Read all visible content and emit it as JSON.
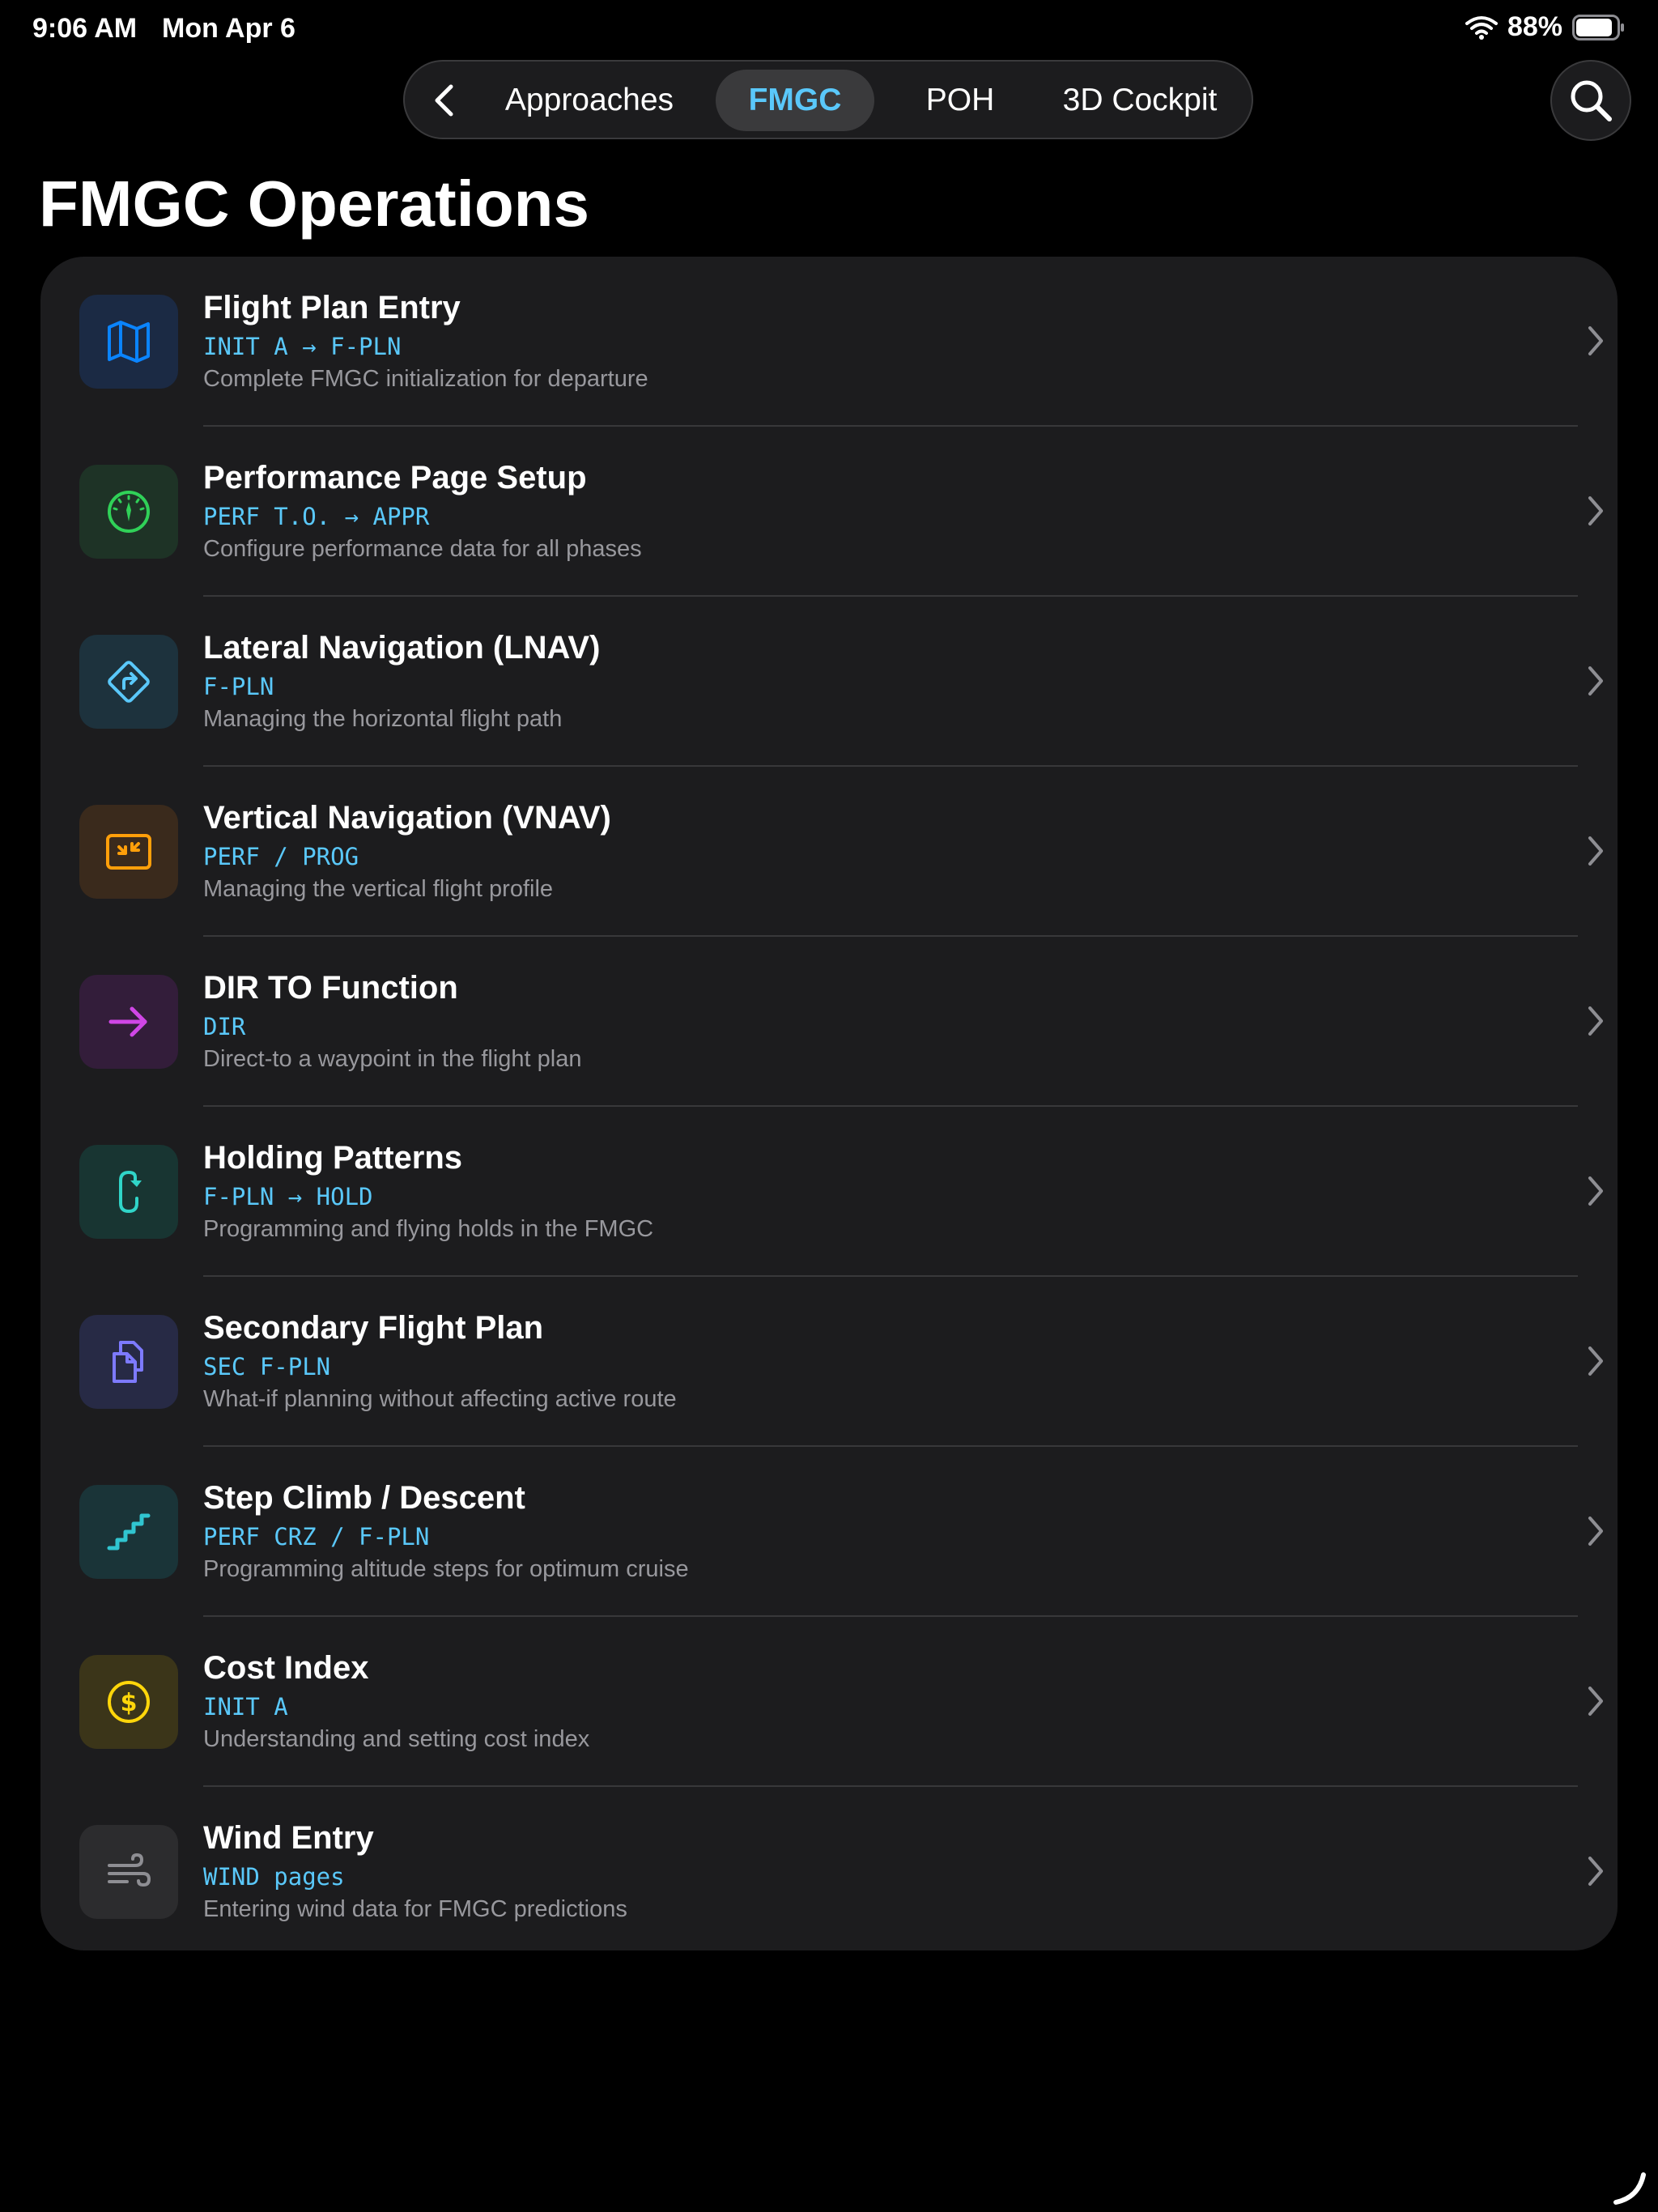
{
  "status_bar": {
    "time": "9:06 AM",
    "date": "Mon Apr 6",
    "battery": "88%",
    "battery_level": 0.88
  },
  "nav": {
    "back_icon": "chevron-left-icon",
    "tabs": [
      {
        "label": "Approaches",
        "active": false
      },
      {
        "label": "FMGC",
        "active": true
      },
      {
        "label": "POH",
        "active": false
      },
      {
        "label": "3D Cockpit",
        "active": false
      }
    ],
    "search_icon": "magnifier-icon"
  },
  "page": {
    "title": "FMGC Operations"
  },
  "items": [
    {
      "title": "Flight Plan Entry",
      "code": "INIT A → F-PLN",
      "desc": "Complete FMGC initialization for departure",
      "icon": "map-icon",
      "color": "#0a84ff",
      "bg": "#1b2a44"
    },
    {
      "title": "Performance Page Setup",
      "code": "PERF T.O. → APPR",
      "desc": "Configure performance data for all phases",
      "icon": "gauge-icon",
      "color": "#30d158",
      "bg": "#1e3326"
    },
    {
      "title": "Lateral Navigation (LNAV)",
      "code": "F-PLN",
      "desc": "Managing the horizontal flight path",
      "icon": "turn-right-sign-icon",
      "color": "#5ac8fa",
      "bg": "#1d323d"
    },
    {
      "title": "Vertical Navigation (VNAV)",
      "code": "PERF / PROG",
      "desc": "Managing the vertical flight profile",
      "icon": "compress-icon",
      "color": "#ff9f0a",
      "bg": "#3a2a1c"
    },
    {
      "title": "DIR TO Function",
      "code": "DIR",
      "desc": "Direct-to a waypoint in the flight plan",
      "icon": "arrow-right-icon",
      "color": "#d046e6",
      "bg": "#331d3a"
    },
    {
      "title": "Holding Patterns",
      "code": "F-PLN → HOLD",
      "desc": "Programming and flying holds in the FMGC",
      "icon": "hold-loop-icon",
      "color": "#30d5c8",
      "bg": "#183532"
    },
    {
      "title": "Secondary Flight Plan",
      "code": "SEC F-PLN",
      "desc": "What-if planning without affecting active route",
      "icon": "documents-icon",
      "color": "#7d7aff",
      "bg": "#272a45"
    },
    {
      "title": "Step Climb / Descent",
      "code": "PERF CRZ / F-PLN",
      "desc": "Programming altitude steps for optimum cruise",
      "icon": "stairs-icon",
      "color": "#30c5d0",
      "bg": "#1a3438"
    },
    {
      "title": "Cost Index",
      "code": "INIT A",
      "desc": "Understanding and setting cost index",
      "icon": "dollar-circle-icon",
      "color": "#ffd60a",
      "bg": "#3b3519"
    },
    {
      "title": "Wind Entry",
      "code": "WIND pages",
      "desc": "Entering wind data for FMGC predictions",
      "icon": "wind-icon",
      "color": "#8e8e93",
      "bg": "#2c2c2e"
    }
  ]
}
